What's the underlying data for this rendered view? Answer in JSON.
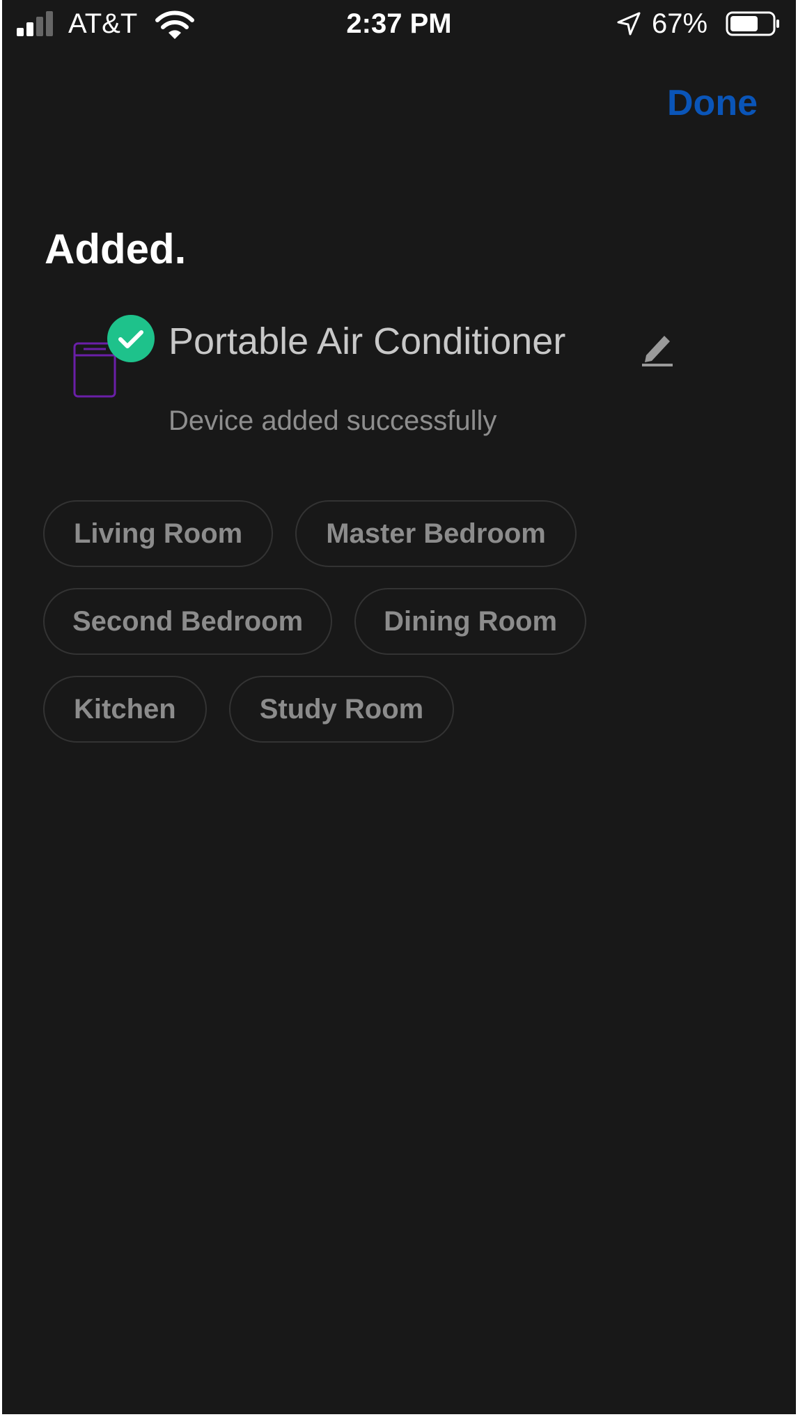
{
  "status_bar": {
    "carrier": "AT&T",
    "time": "2:37 PM",
    "battery_percent": "67%",
    "signal_icon": "cellular-signal-icon",
    "wifi_icon": "wifi-icon",
    "location_icon": "location-arrow-icon",
    "battery_icon": "battery-icon",
    "battery_level": 0.67
  },
  "header": {
    "done_label": "Done",
    "accent_color": "#0a55b8"
  },
  "page": {
    "title": "Added."
  },
  "device": {
    "name": "Portable Air Conditioner",
    "status": "Device added successfully",
    "device_icon": "air-conditioner-icon",
    "badge_icon": "checkmark-circle-icon",
    "edit_icon": "pencil-icon",
    "badge_color": "#1ec28b",
    "device_icon_color": "#6a1fa8"
  },
  "rooms": [
    {
      "label": "Living Room"
    },
    {
      "label": "Master Bedroom"
    },
    {
      "label": "Second Bedroom"
    },
    {
      "label": "Dining Room"
    },
    {
      "label": "Kitchen"
    },
    {
      "label": "Study Room"
    }
  ]
}
